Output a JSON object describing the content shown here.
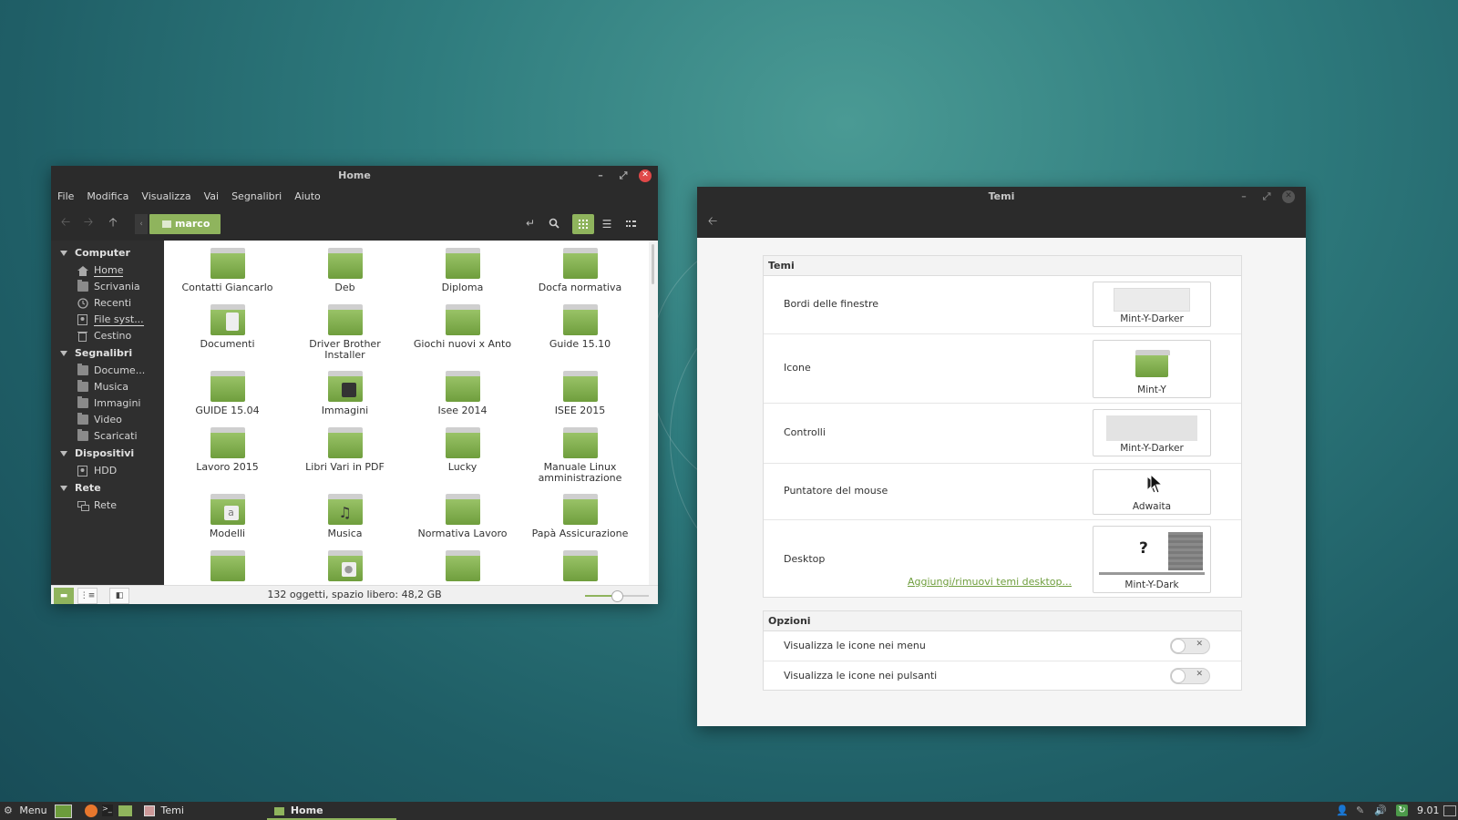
{
  "file_manager": {
    "title": "Home",
    "menu": [
      "File",
      "Modifica",
      "Visualizza",
      "Vai",
      "Segnalibri",
      "Aiuto"
    ],
    "breadcrumb": "marco",
    "sidebar": {
      "computer": {
        "heading": "Computer",
        "items": [
          "Home",
          "Scrivania",
          "Recenti",
          "File syst...",
          "Cestino"
        ]
      },
      "bookmarks": {
        "heading": "Segnalibri",
        "items": [
          "Docume...",
          "Musica",
          "Immagini",
          "Video",
          "Scaricati"
        ]
      },
      "devices": {
        "heading": "Dispositivi",
        "items": [
          "HDD"
        ]
      },
      "network": {
        "heading": "Rete",
        "items": [
          "Rete"
        ]
      }
    },
    "files": [
      "Contatti Giancarlo",
      "Deb",
      "Diploma",
      "Docfa normativa",
      "Documenti",
      "Driver Brother Installer",
      "Giochi nuovi x Anto",
      "Guide 15.10",
      "GUIDE 15.04",
      "Immagini",
      "Isee 2014",
      "ISEE 2015",
      "Lavoro 2015",
      "Libri Vari in PDF",
      "Lucky",
      "Manuale Linux amministrazione",
      "Modelli",
      "Musica",
      "Normativa Lavoro",
      "Papà Assicurazione"
    ],
    "status": "132 oggetti, spazio libero: 48,2 GB",
    "zoom_fraction": 0.5
  },
  "themes_window": {
    "title": "Temi",
    "themes_section": {
      "heading": "Temi",
      "rows": [
        {
          "label": "Bordi delle finestre",
          "value": "Mint-Y-Darker"
        },
        {
          "label": "Icone",
          "value": "Mint-Y"
        },
        {
          "label": "Controlli",
          "value": "Mint-Y-Darker"
        },
        {
          "label": "Puntatore del mouse",
          "value": "Adwaita"
        },
        {
          "label": "Desktop",
          "value": "Mint-Y-Dark"
        }
      ],
      "desktop_link": "Aggiungi/rimuovi temi desktop...",
      "desktop_preview_symbol": "?"
    },
    "options_section": {
      "heading": "Opzioni",
      "rows": [
        {
          "label": "Visualizza le icone nei menu",
          "enabled": false
        },
        {
          "label": "Visualizza le icone nei pulsanti",
          "enabled": false
        }
      ]
    }
  },
  "taskbar": {
    "menu_label": "Menu",
    "windows": [
      "Temi",
      "Home"
    ],
    "clock": "9.01"
  },
  "colors": {
    "accent": "#8fb45d",
    "titlebar": "#2b2b2b",
    "sidebar": "#2f2f2f",
    "link": "#6f9e3d"
  }
}
